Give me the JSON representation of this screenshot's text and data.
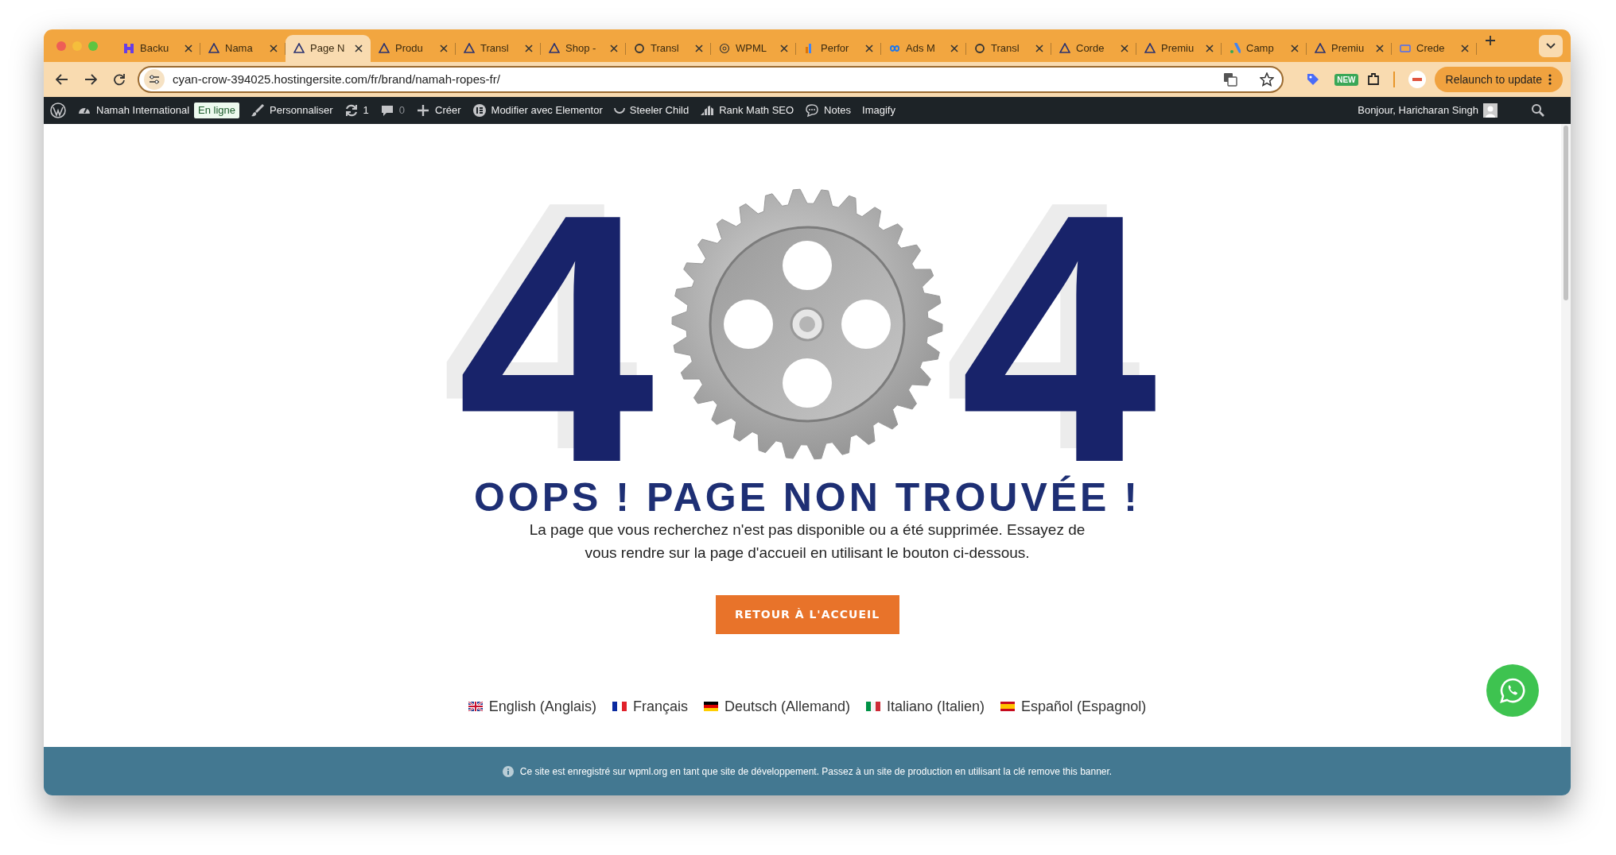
{
  "browser": {
    "tabs": [
      {
        "label": "Backu",
        "selected": false
      },
      {
        "label": "Nama",
        "selected": false
      },
      {
        "label": "Page N",
        "selected": true
      },
      {
        "label": "Produ",
        "selected": false
      },
      {
        "label": "Transl",
        "selected": false
      },
      {
        "label": "Shop -",
        "selected": false
      },
      {
        "label": "Transl",
        "selected": false
      },
      {
        "label": "WPML",
        "selected": false
      },
      {
        "label": "Perfor",
        "selected": false
      },
      {
        "label": "Ads M",
        "selected": false
      },
      {
        "label": "Transl",
        "selected": false
      },
      {
        "label": "Corde",
        "selected": false
      },
      {
        "label": "Premiu",
        "selected": false
      },
      {
        "label": "Camp",
        "selected": false
      },
      {
        "label": "Premiu",
        "selected": false
      },
      {
        "label": "Crede",
        "selected": false
      }
    ],
    "address": "cyan-crow-394025.hostingersite.com/fr/brand/namah-ropes-fr/",
    "extension_badge": "NEW",
    "update_button": "Relaunch to update"
  },
  "admin_bar": {
    "items": [
      {
        "label": "Namah International",
        "badge": "En ligne"
      },
      {
        "label": "Personnaliser"
      },
      {
        "label": "1"
      },
      {
        "label": "0"
      },
      {
        "label": "Créer"
      },
      {
        "label": "Modifier avec Elementor"
      },
      {
        "label": "Steeler Child"
      },
      {
        "label": "Rank Math SEO"
      },
      {
        "label": "Notes"
      },
      {
        "label": "Imagify"
      }
    ],
    "greeting": "Bonjour, Haricharan Singh"
  },
  "page": {
    "digits": [
      "4",
      "4"
    ],
    "heading": "OOPS ! PAGE NON TROUVÉE !",
    "message": "La page que vous recherchez n'est pas disponible ou a été supprimée. Essayez de vous rendre sur la page d'accueil en utilisant le bouton ci-dessous.",
    "button": "RETOUR À L'ACCUEIL",
    "languages": [
      {
        "label": "English (Anglais)"
      },
      {
        "label": "Français"
      },
      {
        "label": "Deutsch (Allemand)"
      },
      {
        "label": "Italiano (Italien)"
      },
      {
        "label": "Español (Espagnol)"
      }
    ]
  },
  "banner": "Ce site est enregistré sur wpml.org en tant que site de développement. Passez à un site de production en utilisant la clé remove this banner."
}
